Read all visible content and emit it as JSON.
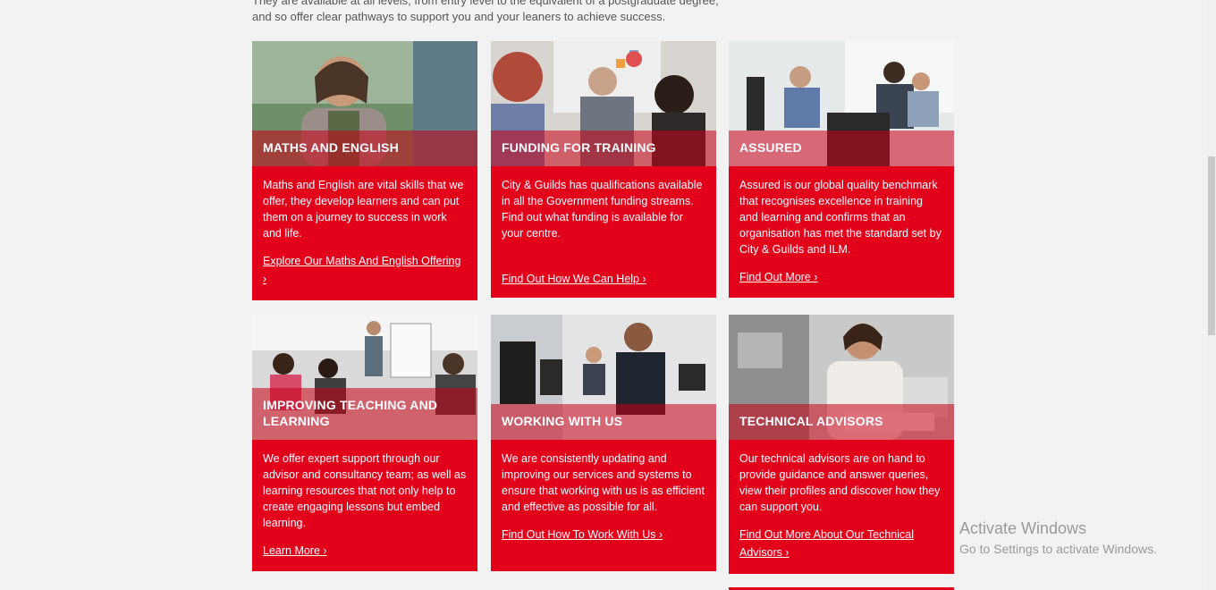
{
  "intro": {
    "line1": "They are available at all levels, from entry level to the equivalent of a postgraduate degree,",
    "line2": "and so offer clear pathways to support you and your leaners to achieve success."
  },
  "cards": [
    {
      "title": "MATHS AND ENGLISH",
      "description": "Maths and English are vital skills that we offer, they develop learners and can put them on a journey to success in work and life.",
      "link": "Explore Our Maths And English Offering ›"
    },
    {
      "title": "FUNDING FOR TRAINING",
      "description": "City & Guilds has qualifications available in all the Government funding streams. Find out what funding is available for your centre.",
      "link": "Find Out How We Can Help ›"
    },
    {
      "title": "ASSURED",
      "description": "Assured is our global quality benchmark that recognises excellence in training and learning and confirms that an organisation has met the standard set by City & Guilds and ILM.",
      "link": "Find Out More ›"
    },
    {
      "title": "IMPROVING TEACHING AND LEARNING",
      "description": "We offer expert support through our advisor and consultancy team; as well as learning resources that not only help to create engaging lessons but embed learning.",
      "link": "Learn More ›"
    },
    {
      "title": "WORKING WITH US",
      "description": "We are consistently updating and improving our services and systems to ensure that working with us is as efficient and effective as possible for all.",
      "link": "Find Out How To Work With Us ›"
    },
    {
      "title": "TECHNICAL ADVISORS",
      "description": "Our technical advisors are on hand to provide guidance and answer queries, view their profiles and discover how they can support you.",
      "link": "Find Out More About Our Technical Advisors ›"
    }
  ],
  "watermark": {
    "title": "Activate Windows",
    "subtitle": "Go to Settings to activate Windows."
  },
  "colors": {
    "brand_red": "#e3001b",
    "page_bg": "#f2f2f2"
  }
}
